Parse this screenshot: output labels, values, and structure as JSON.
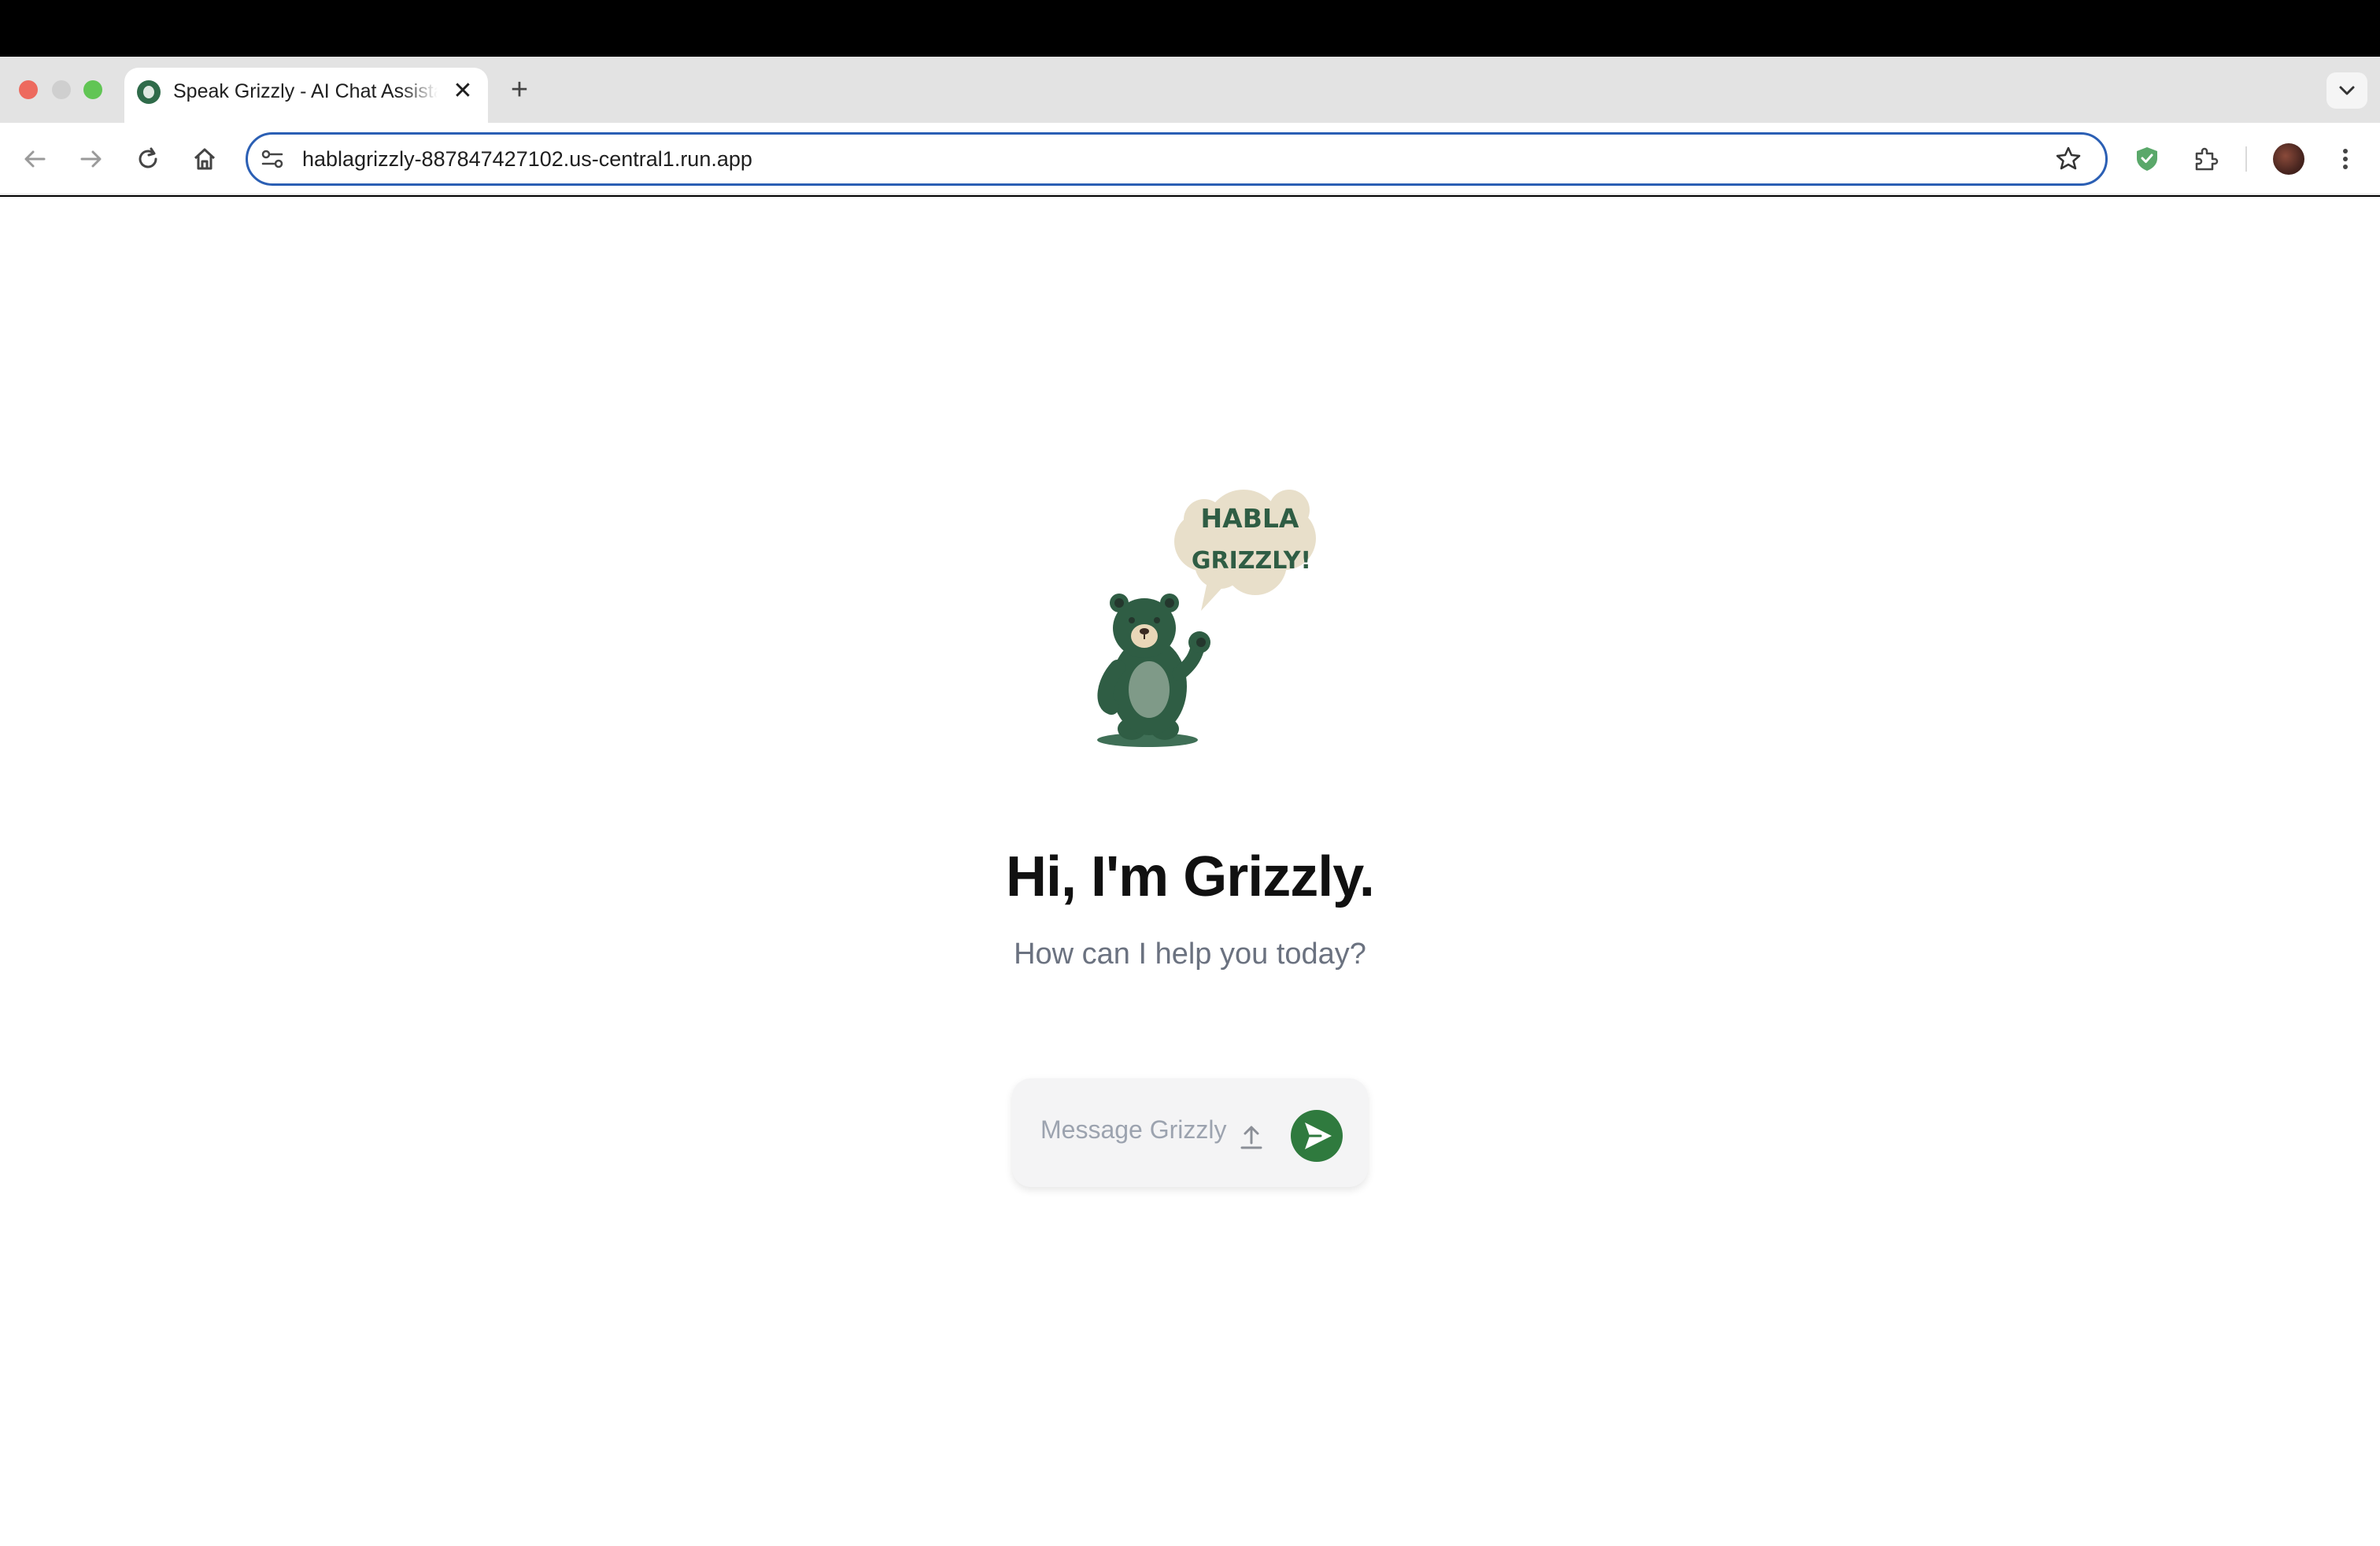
{
  "browser": {
    "tab": {
      "title": "Speak Grizzly - AI Chat Assistant",
      "close_glyph": "✕"
    },
    "new_tab_glyph": "+",
    "address": "hablagrizzly-887847427102.us-central1.run.app",
    "icons": [
      "back-icon",
      "forward-icon",
      "reload-icon",
      "home-icon",
      "site-settings-icon",
      "bookmark-star-icon",
      "shield-extension-icon",
      "extensions-puzzle-icon",
      "profile-avatar",
      "kebab-menu-icon",
      "tab-search-chevron-icon"
    ]
  },
  "hero": {
    "speech_bubble_line1": "HABLA",
    "speech_bubble_line2": "GRIZZLY!",
    "title": "Hi, I'm Grizzly.",
    "subtitle": "How can I help you today?"
  },
  "composer": {
    "placeholder": "Message Grizzly",
    "value": ""
  },
  "colors": {
    "accent": "#2f7a3e",
    "bear": "#2f5d44",
    "bubble": "#e8dfca",
    "omnibox_border": "#2b5fb4"
  }
}
